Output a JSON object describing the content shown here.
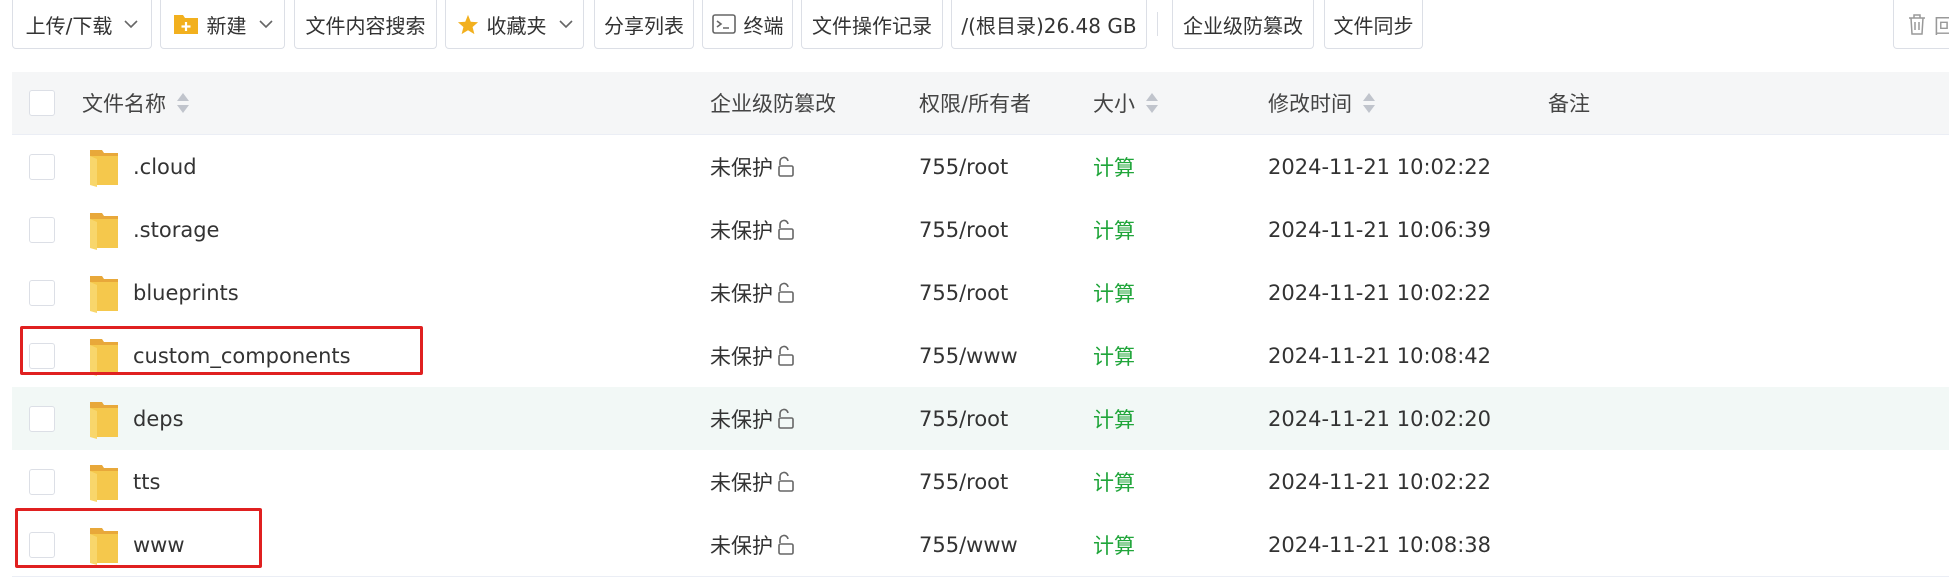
{
  "toolbar": {
    "upload_download": "上传/下载",
    "new": "新建",
    "content_search": "文件内容搜索",
    "favorites": "收藏夹",
    "share_list": "分享列表",
    "terminal": "终端",
    "operation_log": "文件操作记录",
    "root_disk": "/(根目录)26.48 GB",
    "tamper_proof": "企业级防篡改",
    "file_sync": "文件同步",
    "recycle_partial": "回"
  },
  "columns": {
    "name": "文件名称",
    "tamper": "企业级防篡改",
    "perm_owner": "权限/所有者",
    "size": "大小",
    "mtime": "修改时间",
    "note": "备注"
  },
  "rows": [
    {
      "name": ".cloud",
      "protection": "未保护",
      "perm": "755/root",
      "size": "计算",
      "mtime": "2024-11-21 10:02:22"
    },
    {
      "name": ".storage",
      "protection": "未保护",
      "perm": "755/root",
      "size": "计算",
      "mtime": "2024-11-21 10:06:39"
    },
    {
      "name": "blueprints",
      "protection": "未保护",
      "perm": "755/root",
      "size": "计算",
      "mtime": "2024-11-21 10:02:22"
    },
    {
      "name": "custom_components",
      "protection": "未保护",
      "perm": "755/www",
      "size": "计算",
      "mtime": "2024-11-21 10:08:42"
    },
    {
      "name": "deps",
      "protection": "未保护",
      "perm": "755/root",
      "size": "计算",
      "mtime": "2024-11-21 10:02:20"
    },
    {
      "name": "tts",
      "protection": "未保护",
      "perm": "755/root",
      "size": "计算",
      "mtime": "2024-11-21 10:02:22"
    },
    {
      "name": "www",
      "protection": "未保护",
      "perm": "755/www",
      "size": "计算",
      "mtime": "2024-11-21 10:08:38"
    }
  ],
  "colors": {
    "accent_green": "#20a53a",
    "highlight_red": "#e02020",
    "folder_yellow": "#f5c84c",
    "hover_row": "#f2f8f6"
  },
  "icons": [
    "chevron-down-icon",
    "new-folder-icon",
    "star-icon",
    "terminal-icon",
    "trash-icon",
    "sort-icon",
    "folder-icon",
    "unlock-icon"
  ]
}
